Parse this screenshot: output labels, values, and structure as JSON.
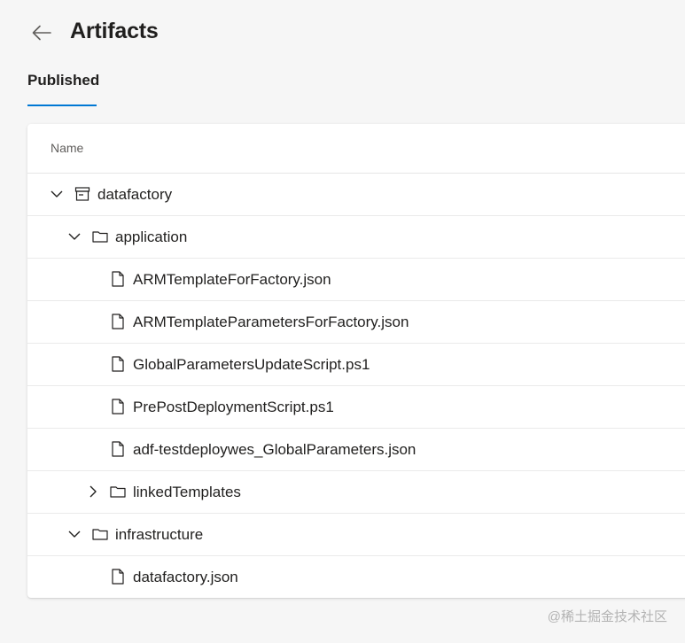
{
  "header": {
    "title": "Artifacts"
  },
  "tabs": [
    {
      "label": "Published",
      "selected": true
    }
  ],
  "table": {
    "column_header": "Name",
    "rows": [
      {
        "label": "datafactory",
        "type": "artifact",
        "expanded": true
      },
      {
        "label": "application",
        "type": "folder",
        "expanded": true
      },
      {
        "label": "ARMTemplateForFactory.json",
        "type": "file"
      },
      {
        "label": "ARMTemplateParametersForFactory.json",
        "type": "file"
      },
      {
        "label": "GlobalParametersUpdateScript.ps1",
        "type": "file"
      },
      {
        "label": "PrePostDeploymentScript.ps1",
        "type": "file"
      },
      {
        "label": "adf-testdeploywes_GlobalParameters.json",
        "type": "file"
      },
      {
        "label": "linkedTemplates",
        "type": "folder",
        "expanded": false
      },
      {
        "label": "infrastructure",
        "type": "folder",
        "expanded": true
      },
      {
        "label": "datafactory.json",
        "type": "file"
      }
    ]
  },
  "watermark": "@稀土掘金技术社区",
  "colors": {
    "accent": "#0078d4",
    "background": "#f6f6f6",
    "text": "#201f1e"
  }
}
